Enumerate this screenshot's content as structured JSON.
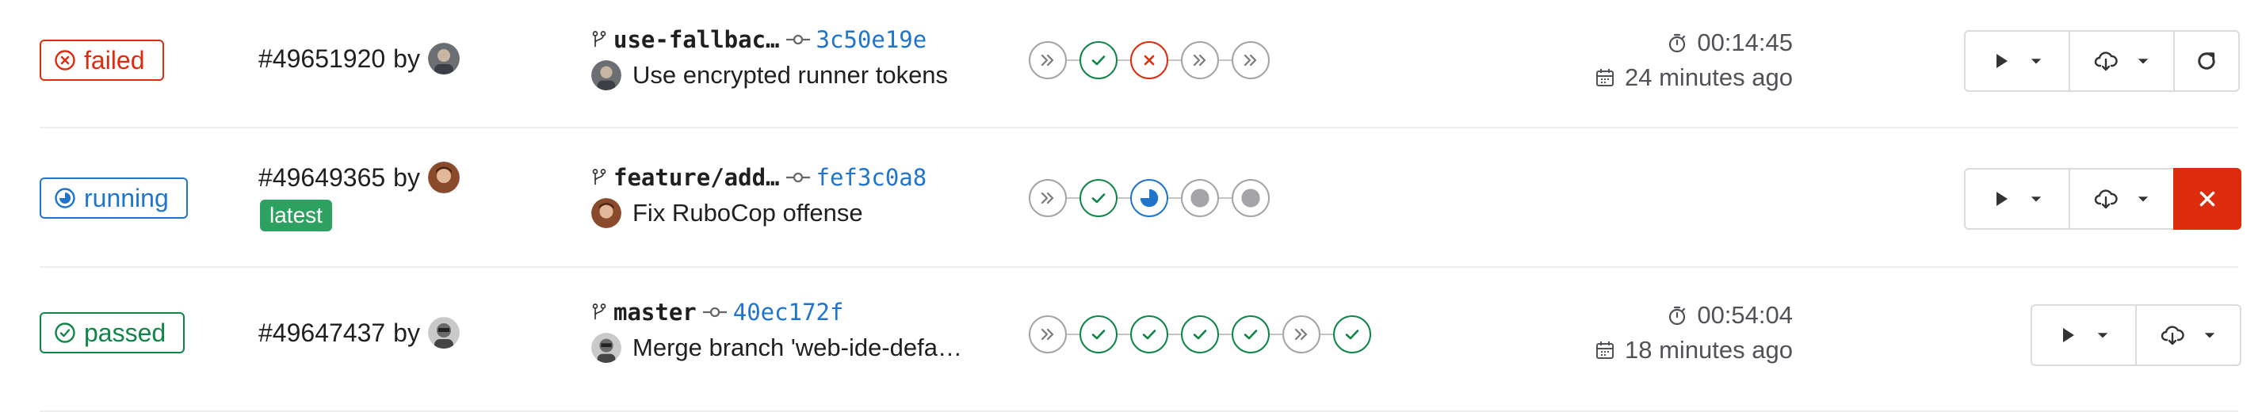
{
  "pipelines": [
    {
      "status": "failed",
      "status_label": "failed",
      "id": "#49651920",
      "by": "by",
      "ref": "use-fallbac…",
      "sha": "3c50e19e",
      "message": "Use encrypted runner tokens",
      "stages": [
        "skipped",
        "success",
        "failed",
        "skipped",
        "skipped"
      ],
      "duration": "00:14:45",
      "finished": "24 minutes ago",
      "actions": [
        "play",
        "download",
        "retry"
      ]
    },
    {
      "status": "running",
      "status_label": "running",
      "id": "#49649365",
      "by": "by",
      "badge": "latest",
      "ref": "feature/add…",
      "sha": "fef3c0a8",
      "message": "Fix RuboCop offense",
      "stages": [
        "skipped",
        "success",
        "running",
        "created",
        "created"
      ],
      "actions": [
        "play",
        "download",
        "cancel"
      ]
    },
    {
      "status": "passed",
      "status_label": "passed",
      "id": "#49647437",
      "by": "by",
      "ref": "master",
      "sha": "40ec172f",
      "message": "Merge branch 'web-ide-defa…",
      "stages": [
        "skipped",
        "success",
        "success",
        "success",
        "success",
        "skipped",
        "success"
      ],
      "duration": "00:54:04",
      "finished": "18 minutes ago",
      "actions": [
        "play",
        "download"
      ]
    }
  ],
  "colors": {
    "failed": "#dd2b0e",
    "running": "#1f75cb",
    "passed": "#108548",
    "latest_badge": "#2da160"
  },
  "icons": {
    "status_failed": "status-failed-icon",
    "status_running": "status-running-icon",
    "status_passed": "status-passed-icon",
    "branch": "branch-icon",
    "commit": "commit-icon",
    "timer": "timer-icon",
    "calendar": "calendar-icon",
    "play": "play-icon",
    "chevron": "chevron-down-icon",
    "download": "cloud-download-icon",
    "retry": "retry-icon",
    "cancel": "close-icon"
  }
}
